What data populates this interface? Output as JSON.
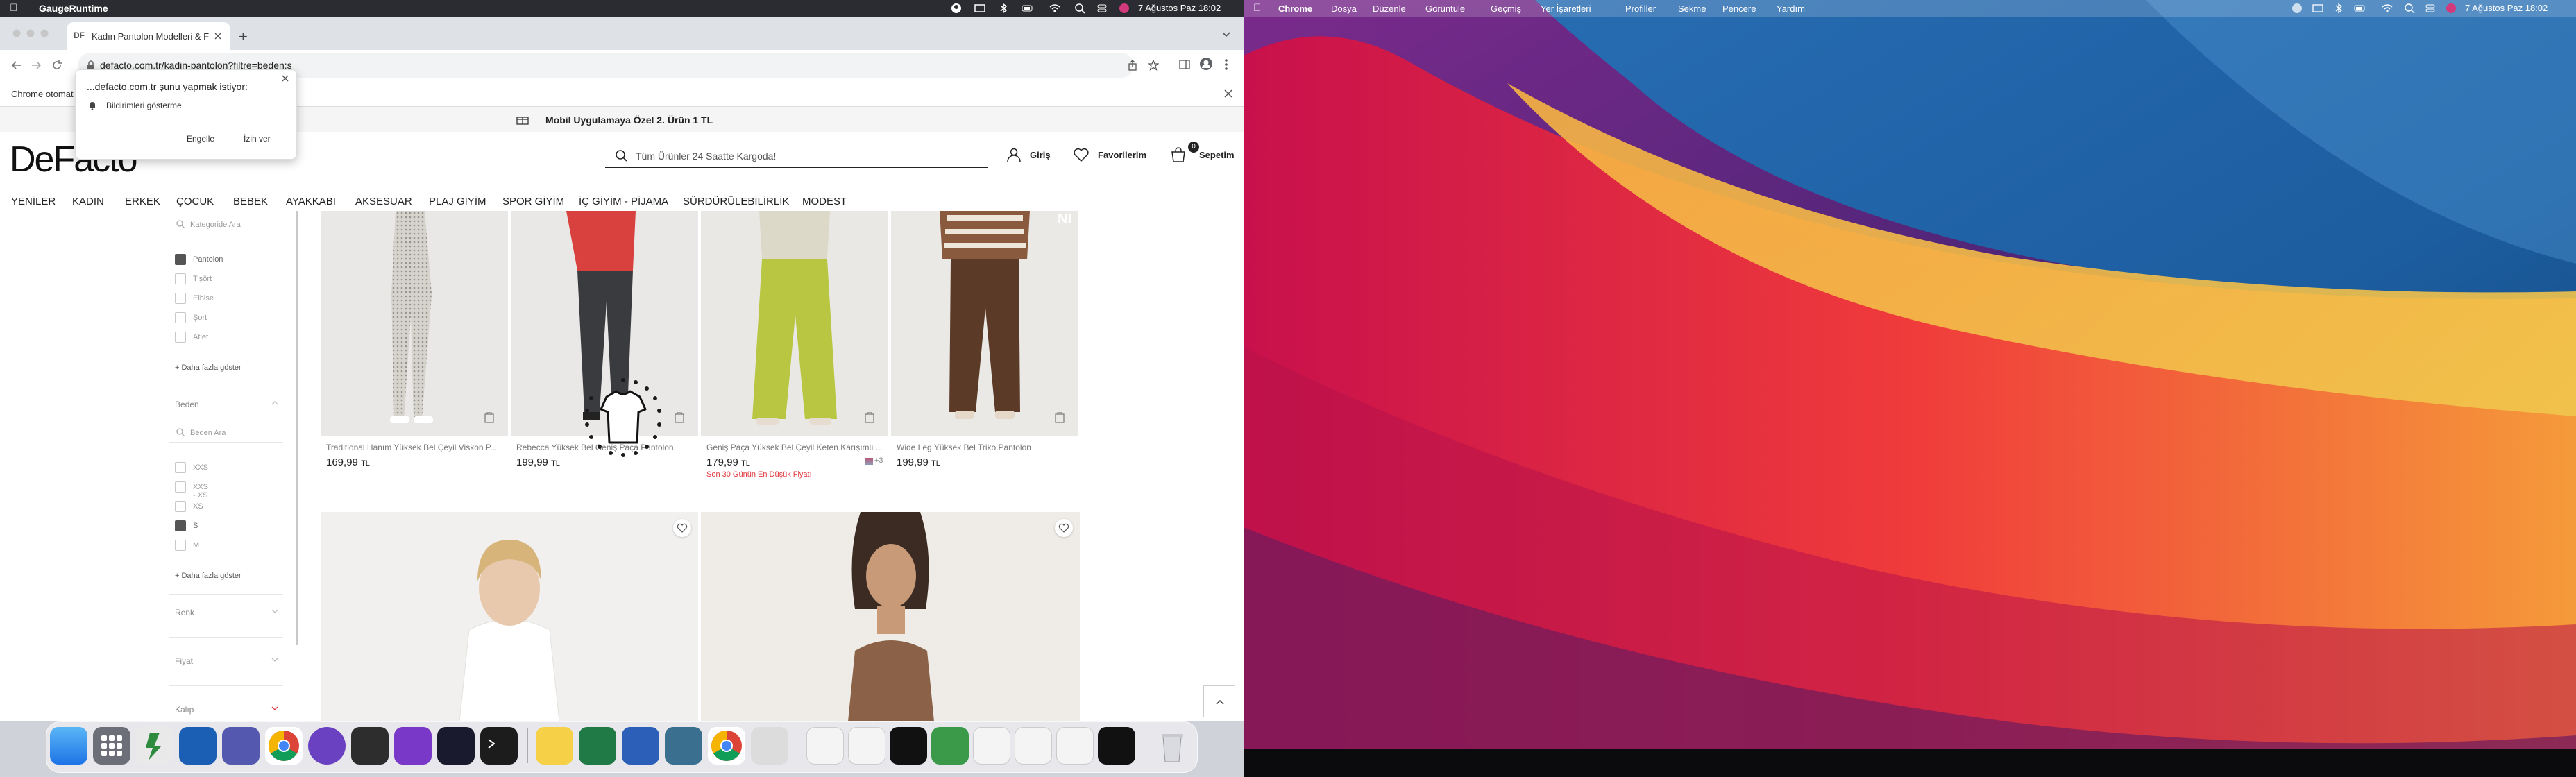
{
  "menubar_left": {
    "app_name": "GaugeRuntime",
    "date_time": "7 Ağustos Paz  18:02"
  },
  "menubar_right": {
    "items": [
      "Chrome",
      "Dosya",
      "Düzenle",
      "Görüntüle",
      "Geçmiş",
      "Yer İşaretleri",
      "Profiller",
      "Sekme",
      "Pencere",
      "Yardım"
    ],
    "date_time": "7 Ağustos Paz  18:02"
  },
  "browser": {
    "tab_title": "Kadın Pantolon Modelleri & Fiy",
    "url": "defacto.com.tr/kadin-pantolon?filtre=beden:s",
    "infobar_text": "Chrome otomat"
  },
  "permission_popup": {
    "title": "...defacto.com.tr şunu yapmak istiyor:",
    "item": "Bildirimleri gösterme",
    "block_label": "Engelle",
    "allow_label": "İzin ver"
  },
  "site": {
    "promo_banner": "Mobil Uygulamaya Özel 2. Ürün 1 TL",
    "logo": "DeFacto",
    "search_placeholder": "Tüm Ürünler 24 Saatte Kargoda!",
    "login_label": "Giriş",
    "favorites_label": "Favorilerim",
    "cart_label": "Sepetim",
    "cart_count": "0",
    "nav": [
      "YENİLER",
      "KADIN",
      "ERKEK",
      "ÇOCUK",
      "BEBEK",
      "AYAKKABI",
      "AKSESUAR",
      "PLAJ GİYİM",
      "SPOR GİYİM",
      "İÇ GİYİM - PİJAMA",
      "SÜRDÜRÜLEBİLİRLİK",
      "MODEST"
    ]
  },
  "sidebar": {
    "category_search_placeholder": "Kategoride Ara",
    "categories": [
      {
        "label": "Pantolon",
        "checked": true
      },
      {
        "label": "Tişört",
        "checked": false
      },
      {
        "label": "Elbise",
        "checked": false
      },
      {
        "label": "Şort",
        "checked": false
      },
      {
        "label": "Atlet",
        "checked": false
      }
    ],
    "more_label_1": "+ Daha fazla göster",
    "size_header": "Beden",
    "size_search_placeholder": "Beden Ara",
    "sizes": [
      {
        "label": "XXS",
        "checked": false
      },
      {
        "label": "XXS - XS",
        "checked": false
      },
      {
        "label": "XS",
        "checked": false
      },
      {
        "label": "S",
        "checked": true
      },
      {
        "label": "M",
        "checked": false
      }
    ],
    "more_label_2": "+ Daha fazla göster",
    "color_header": "Renk",
    "price_header": "Fiyat",
    "fit_header": "Kalıp"
  },
  "products": [
    {
      "name": "Traditional Hanım Yüksek Bel Çeyil Viskon P...",
      "price": "169,99",
      "currency": "TL",
      "note": ""
    },
    {
      "name": "Rebecca Yüksek Bel Geniş Paça Pantolon",
      "price": "199,99",
      "currency": "TL",
      "note": ""
    },
    {
      "name": "Geniş Paça Yüksek Bel Çeyil Keten Karışımlı ...",
      "price": "179,99",
      "currency": "TL",
      "note": "Son 30 Günün En Düşük Fiyatı",
      "swatch_extra": "+3"
    },
    {
      "name": "Wide Leg Yüksek Bel Triko Pantolon",
      "price": "199,99",
      "currency": "TL",
      "note": ""
    }
  ],
  "colors": {
    "menubar": "#2a2c31",
    "tabstrip": "#dee1e6",
    "accent_red": "#e0383e",
    "dark_text": "#222222"
  }
}
